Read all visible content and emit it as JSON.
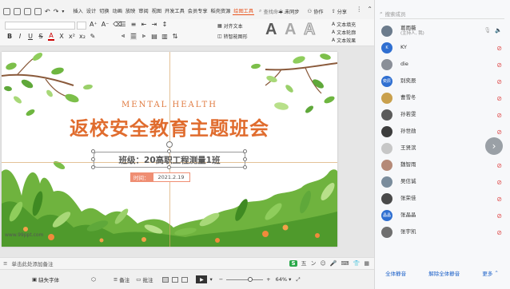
{
  "menu": {
    "items": [
      "插入",
      "设计",
      "切换",
      "动画",
      "放映",
      "审阅",
      "视图",
      "开发工具",
      "会员专享",
      "稻壳资源",
      "绘图工具"
    ],
    "active_index": 10,
    "search_cmd": "查找命令...",
    "not_synced": "未同步",
    "collaborate": "协作",
    "share": "分享"
  },
  "ribbon": {
    "bold": "B",
    "italic": "I",
    "underline": "U",
    "strike": "S",
    "font_color": "A",
    "shadow": "X",
    "text_style_letters": [
      "A",
      "A",
      "A"
    ],
    "align_text": "对齐文本",
    "convert_smartart": "转智能图形",
    "text_fill": "文本填充",
    "text_outline": "文本轮廓",
    "text_effect": "文本效果"
  },
  "slide": {
    "subtitle": "MENTAL HEALTH",
    "title": "返校安全教育主题班会",
    "class_line": "班级：20高职工程测量1班",
    "date_label": "时间：",
    "date_value": "2021.2.19",
    "watermark_url": "www.99ppt.com"
  },
  "notes": {
    "placeholder": "单击此处添加备注"
  },
  "statusbar": {
    "missing_fonts": "缺失字体",
    "notes_btn": "备注",
    "comments_btn": "批注",
    "zoom": "64%",
    "zoom_fraction": 0.64
  },
  "sidebar": {
    "search_placeholder": "搜索成员",
    "members": [
      {
        "name": "葛雨薇",
        "sub": "(主持人, 我)",
        "avatar_text": "",
        "avatar_color": "#6b7b8c",
        "host": true
      },
      {
        "name": "KY",
        "sub": "",
        "avatar_text": "K",
        "avatar_color": "#2f6fd1",
        "host": false
      },
      {
        "name": "die",
        "sub": "",
        "avatar_text": "",
        "avatar_color": "#8a8f98",
        "host": false
      },
      {
        "name": "别奕辰",
        "sub": "",
        "avatar_text": "奕辰",
        "avatar_color": "#2f6fd1",
        "host": false
      },
      {
        "name": "曹雪冬",
        "sub": "",
        "avatar_text": "",
        "avatar_color": "#c9a04d",
        "host": false
      },
      {
        "name": "孙若雯",
        "sub": "",
        "avatar_text": "",
        "avatar_color": "#5b5b5b",
        "host": false
      },
      {
        "name": "孙世勋",
        "sub": "",
        "avatar_text": "",
        "avatar_color": "#3d3d3d",
        "host": false
      },
      {
        "name": "王贤滨",
        "sub": "",
        "avatar_text": "",
        "avatar_color": "#c7c7c7",
        "host": false
      },
      {
        "name": "魏智雨",
        "sub": "",
        "avatar_text": "",
        "avatar_color": "#b58a78",
        "host": false
      },
      {
        "name": "吴信诚",
        "sub": "",
        "avatar_text": "",
        "avatar_color": "#7a8c9c",
        "host": false
      },
      {
        "name": "张荣佳",
        "sub": "",
        "avatar_text": "",
        "avatar_color": "#4a4a4a",
        "host": false
      },
      {
        "name": "张晶晶",
        "sub": "",
        "avatar_text": "晶晶",
        "avatar_color": "#2f6fd1",
        "host": false
      },
      {
        "name": "张宇凯",
        "sub": "",
        "avatar_text": "",
        "avatar_color": "#6f6f6f",
        "host": false
      }
    ],
    "mute_all": "全体静音",
    "unmute_all": "解除全体静音",
    "more": "更多"
  }
}
